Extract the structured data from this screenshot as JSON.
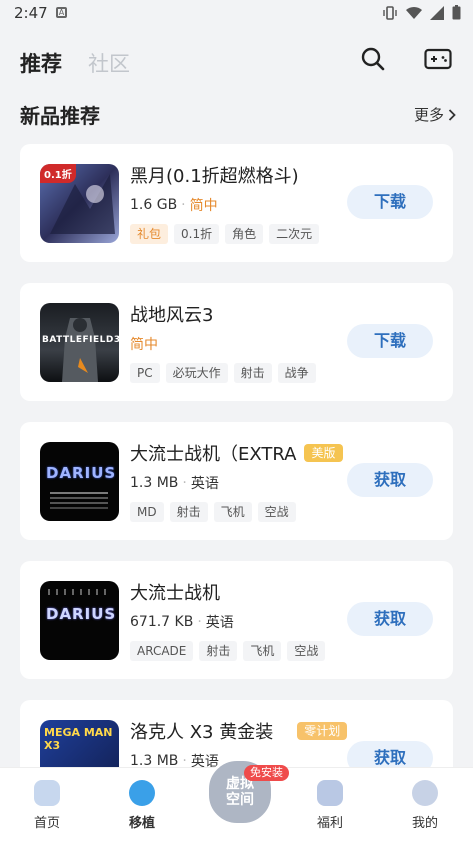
{
  "status_bar": {
    "time": "2:47"
  },
  "header": {
    "tab_active": "推荐",
    "tab_inactive": "社区"
  },
  "section": {
    "title": "新品推荐",
    "more_label": "更多"
  },
  "games": [
    {
      "name": "黑月(0.1折超燃格斗)",
      "size": "1.6 GB",
      "lang": "简中",
      "tags": [
        "礼包",
        "0.1折",
        "角色",
        "二次元"
      ],
      "action": "下载",
      "cover_text": "0.1折"
    },
    {
      "name": "战地风云3",
      "size": "",
      "lang": "简中",
      "tags": [
        "PC",
        "必玩大作",
        "射击",
        "战争"
      ],
      "action": "下载",
      "cover_text": "BATTLEFIELD3"
    },
    {
      "name": "大流士战机（EXTRA",
      "badge": "美版",
      "size": "1.3 MB",
      "lang": "英语",
      "tags": [
        "MD",
        "射击",
        "飞机",
        "空战"
      ],
      "action": "获取",
      "cover_text": "DARIUS"
    },
    {
      "name": "大流士战机",
      "size": "671.7 KB",
      "lang": "英语",
      "tags": [
        "ARCADE",
        "射击",
        "飞机",
        "空战"
      ],
      "action": "获取",
      "cover_text": "DARIUS"
    },
    {
      "name": "洛克人 X3 黄金装",
      "badge": "零计划",
      "size": "1.3 MB",
      "lang": "英语",
      "tags": [],
      "action": "获取",
      "cover_text": "MEGA MAN X3"
    }
  ],
  "tabbar": {
    "home": "首页",
    "port": "移植",
    "virtual_line1": "虚拟",
    "virtual_line2": "空间",
    "install_free": "免安装",
    "welfare": "福利",
    "mine": "我的"
  },
  "colors": {
    "accent": "#2e6fbd",
    "orange": "#e58a2e",
    "bg": "#f2f3f5"
  }
}
